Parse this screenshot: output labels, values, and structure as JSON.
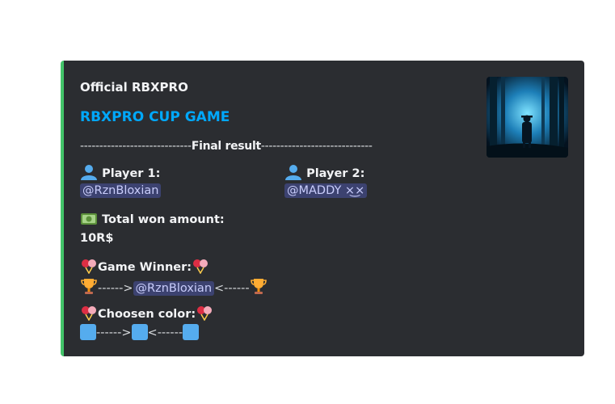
{
  "embed": {
    "accent_color": "#43c46a",
    "author": "Official RBXPRO",
    "title": "RBXPRO CUP GAME",
    "divider": {
      "left_dashes": "-----------------------------",
      "label": "Final result",
      "right_dashes": "-----------------------------"
    },
    "player1": {
      "icon": "bust-icon",
      "label": "Player 1:",
      "mention": "@RznBloxian"
    },
    "player2": {
      "icon": "bust-icon",
      "label": "Player 2:",
      "mention": "@MADDY ×͜×"
    },
    "total": {
      "icon": "money-icon",
      "label": "Total won amount:",
      "value": "10R$"
    },
    "winner": {
      "label": "Game Winner:",
      "arrow_left": "------>",
      "mention": "@RznBloxian",
      "arrow_right": "<------"
    },
    "color": {
      "label": "Choosen color:",
      "arrow_left": "------>",
      "arrow_right": "<------",
      "square_color": "#55acee"
    }
  }
}
